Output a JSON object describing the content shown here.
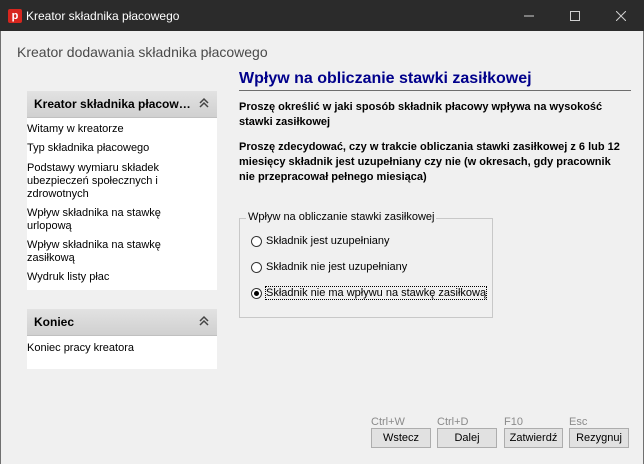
{
  "window": {
    "title": "Kreator składnika płacowego",
    "app_icon_letter": "p",
    "controls": [
      "minimize-icon",
      "maximize-icon",
      "close-icon"
    ]
  },
  "wizard_title": "Kreator dodawania składnika płacowego",
  "sidebar": {
    "panels": [
      {
        "header": "Kreator składnika płacow…",
        "steps": [
          "Witamy w kreatorze",
          "Typ składnika płacowego",
          "Podstawy wymiaru składek ubezpieczeń społecznych i zdrowotnych",
          "Wpływ składnika na stawkę urlopową",
          "Wpływ składnika na stawkę zasiłkową",
          "Wydruk listy płac"
        ]
      },
      {
        "header": "Koniec",
        "steps": [
          "Koniec pracy kreatora"
        ]
      }
    ]
  },
  "content": {
    "heading": "Wpływ na obliczanie stawki zasiłkowej",
    "paragraph1": "Proszę określić w jaki sposób składnik płacowy wpływa na wysokość stawki zasiłkowej",
    "paragraph2": "Proszę zdecydować, czy w trakcie obliczania stawki zasiłkowej z 6 lub 12 miesięcy składnik jest uzupełniany czy nie (w okresach, gdy pracownik nie przepracował pełnego miesiąca)",
    "group": {
      "legend": "Wpływ na obliczanie stawki zasiłkowej",
      "options": [
        "Składnik jest uzupełniany",
        "Składnik nie jest uzupełniany",
        "Składnik nie ma wpływu na stawkę zasiłkową"
      ],
      "selected_index": 2
    }
  },
  "footer": {
    "buttons": [
      {
        "label": "Wstecz",
        "shortcut": "Ctrl+W"
      },
      {
        "label": "Dalej",
        "shortcut": "Ctrl+D"
      },
      {
        "label": "Zatwierdź",
        "shortcut": "F10"
      },
      {
        "label": "Rezygnuj",
        "shortcut": "Esc"
      }
    ]
  },
  "colors": {
    "titlebar": "#2b2b2b",
    "heading": "#00008b",
    "app_icon": "#d7261e"
  }
}
